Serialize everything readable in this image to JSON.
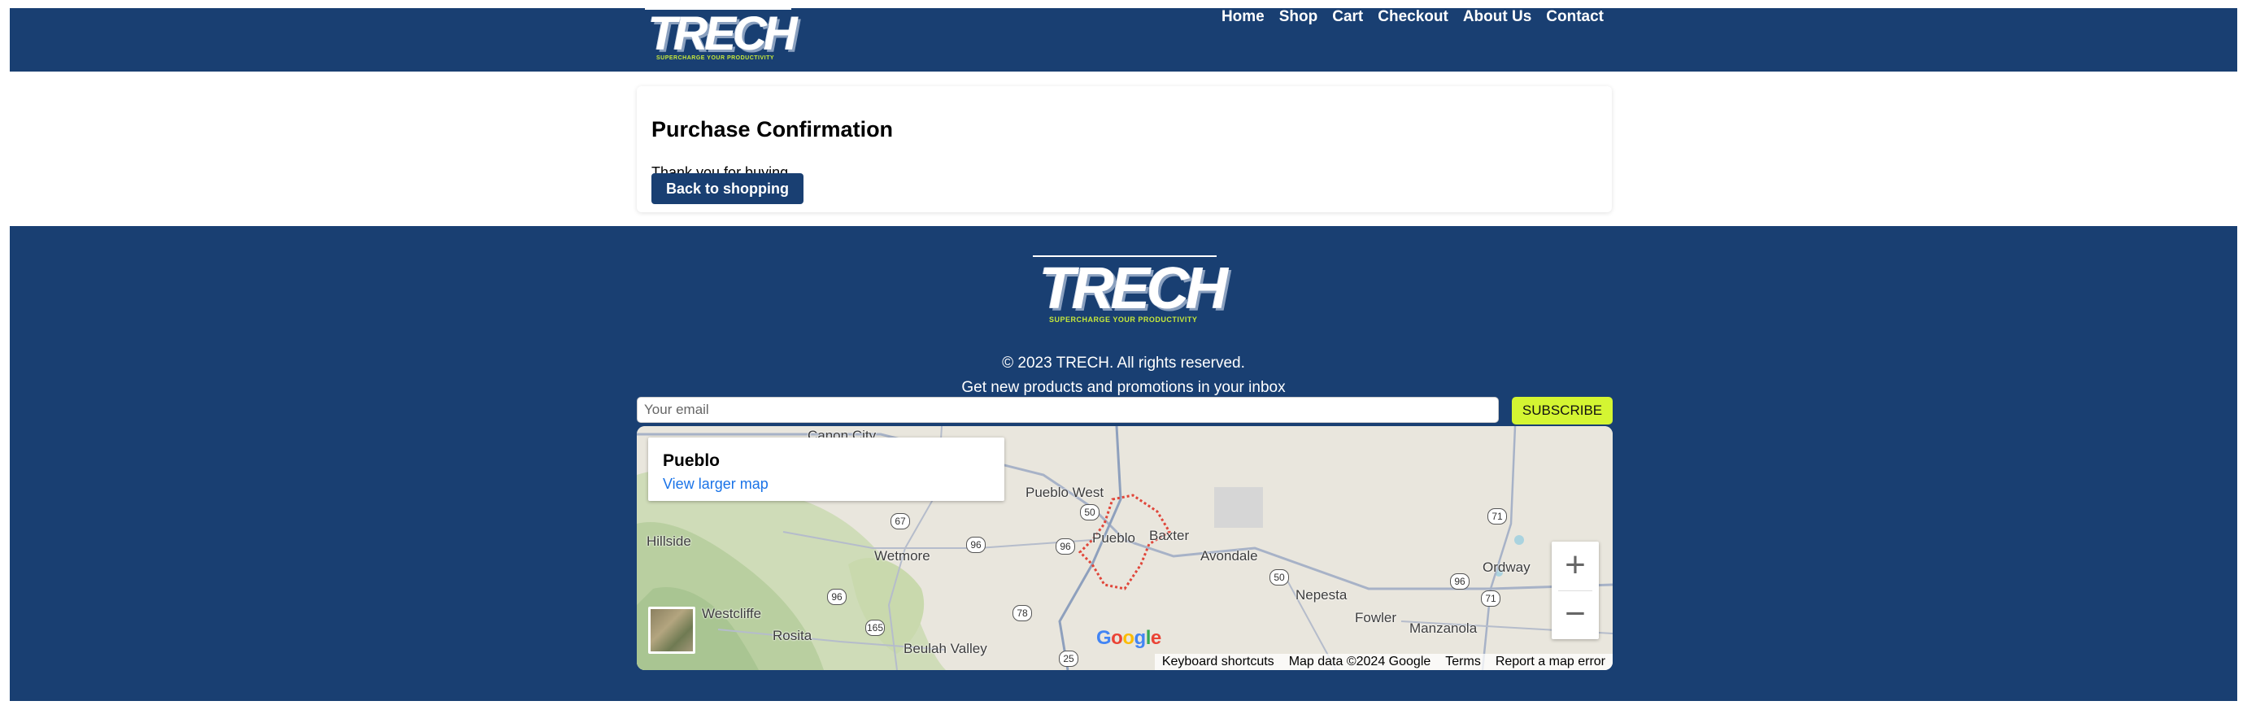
{
  "header": {
    "logo_word": "TRECH",
    "logo_tagline": "SUPERCHARGE YOUR PRODUCTIVITY",
    "nav": [
      {
        "label": "Home"
      },
      {
        "label": "Shop"
      },
      {
        "label": "Cart"
      },
      {
        "label": "Checkout"
      },
      {
        "label": "About Us"
      },
      {
        "label": "Contact"
      }
    ]
  },
  "main": {
    "title": "Purchase Confirmation",
    "message": "Thank you for buying",
    "button_label": "Back to shopping"
  },
  "footer": {
    "logo_word": "TRECH",
    "logo_tagline": "SUPERCHARGE YOUR PRODUCTIVITY",
    "copyright": "© 2023 TRECH. All rights reserved.",
    "promo": "Get new products and promotions in your inbox",
    "email_placeholder": "Your email",
    "subscribe_label": "SUBSCRIBE"
  },
  "map": {
    "place": "Pueblo",
    "larger_map_link": "View larger map",
    "labels": {
      "canon_city": "Canon City",
      "pueblo_west": "Pueblo West",
      "pueblo": "Pueblo",
      "baxter": "Baxter",
      "hillside": "Hillside",
      "wetmore": "Wetmore",
      "avondale": "Avondale",
      "nepesta": "Nepesta",
      "ordway": "Ordway",
      "fowler": "Fowler",
      "manzanola": "Manzanola",
      "westcliffe": "Westcliffe",
      "rosita": "Rosita",
      "beulah_valley": "Beulah Valley"
    },
    "route_shields": {
      "r50a": "50",
      "r67": "67",
      "r96a": "96",
      "r96b": "96",
      "r96c": "96",
      "r96d": "96",
      "r165": "165",
      "r78": "78",
      "r25": "25",
      "r50b": "50",
      "r71a": "71",
      "r71b": "71"
    },
    "zoom_in": "+",
    "zoom_out": "−",
    "google_logo": "Google",
    "attribution": {
      "shortcuts": "Keyboard shortcuts",
      "data": "Map data ©2024 Google",
      "terms": "Terms",
      "report": "Report a map error"
    }
  },
  "colors": {
    "brand_navy": "#193f72",
    "accent_lime": "#d4f532",
    "link_blue": "#1a73e8"
  }
}
